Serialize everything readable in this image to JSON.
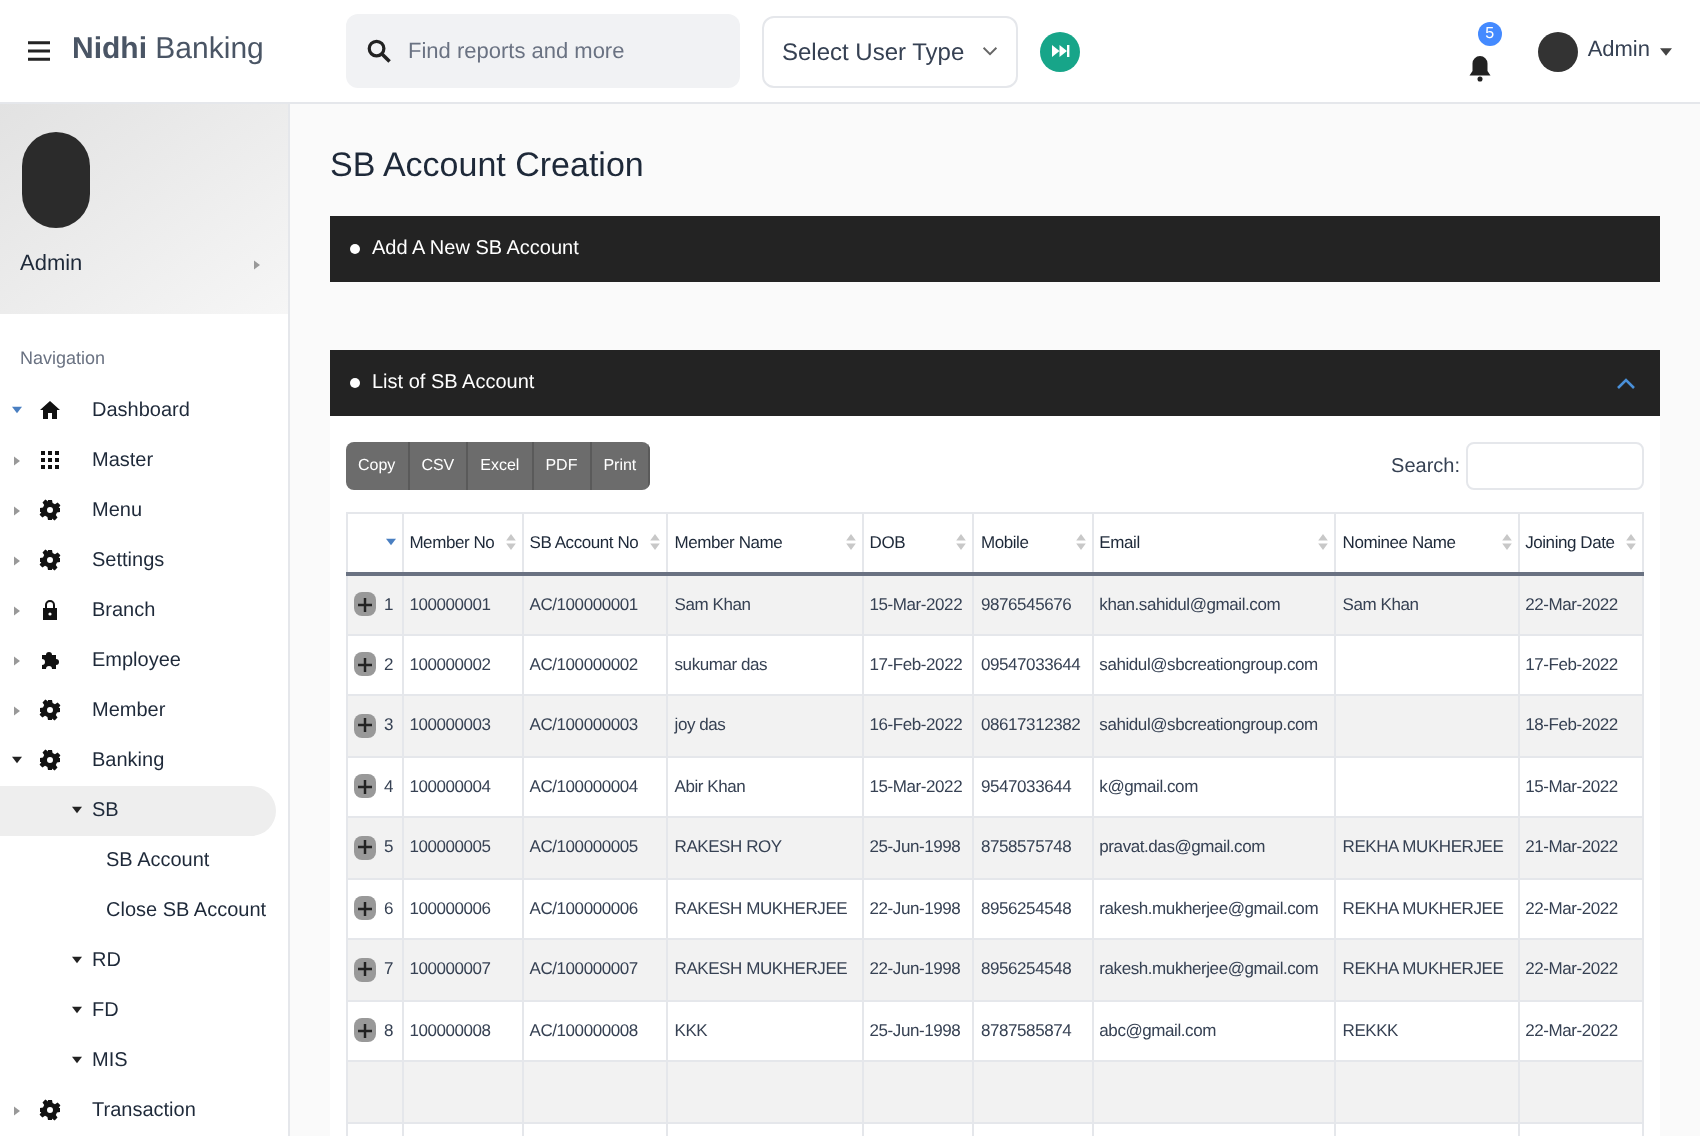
{
  "header": {
    "brand": "**Nidhi** Banking",
    "search": {
      "placeholder": "Find reports and more"
    },
    "user_type_select": {
      "value": "Select User Type"
    },
    "notification_count": "5",
    "user": "Admin"
  },
  "sidebar": {
    "profile_name": "Admin",
    "section_label": "Navigation",
    "items": [
      {
        "label": "Dashboard",
        "expanded": true
      },
      {
        "label": "Master",
        "expanded": false
      },
      {
        "label": "Menu",
        "expanded": false
      },
      {
        "label": "Settings",
        "expanded": false
      },
      {
        "label": "Branch",
        "expanded": false
      },
      {
        "label": "Employee",
        "expanded": false
      },
      {
        "label": "Member",
        "expanded": false
      },
      {
        "label": "Banking",
        "expanded": true,
        "children": [
          {
            "label": "SB",
            "selected": true,
            "children": [
              {
                "label": "SB Account"
              },
              {
                "label": "Close SB Account"
              }
            ]
          },
          {
            "label": "RD",
            "selected": false
          },
          {
            "label": "FD",
            "selected": false
          },
          {
            "label": "MIS",
            "selected": false
          }
        ]
      },
      {
        "label": "Transaction",
        "expanded": false
      }
    ]
  },
  "page": {
    "title": "SB Account Creation",
    "add_panel": {
      "title": "Add A New SB Account"
    },
    "list_panel": {
      "title": "List of SB Account",
      "expanded": true,
      "export_buttons": [
        "Copy",
        "CSV",
        "Excel",
        "PDF",
        "Print"
      ],
      "search_label": "Search:",
      "table": {
        "columns": [
          {
            "sorted": true
          },
          {
            "label": "Member No",
            "sorted": false
          },
          {
            "label": "SB Account No",
            "sorted": false
          },
          {
            "label": "Member Name",
            "sorted": false
          },
          {
            "label": "DOB",
            "sorted": false
          },
          {
            "label": "Mobile",
            "sorted": false
          },
          {
            "label": "Email",
            "sorted": false
          },
          {
            "label": "Nominee Name",
            "sorted": false
          },
          {
            "label": "Joining Date",
            "sorted": false
          }
        ],
        "rows": [
          {
            "cells": [
              "1",
              "100000001",
              "AC/100000001",
              "Sam Khan",
              "15-Mar-2022",
              "9876545676",
              "khan.sahidul@gmail.com",
              "Sam Khan",
              "22-Mar-2022"
            ]
          },
          {
            "cells": [
              "2",
              "100000002",
              "AC/100000002",
              "sukumar das",
              "17-Feb-2022",
              "09547033644",
              "sahidul@sbcreationgroup.com",
              "",
              "17-Feb-2022"
            ]
          },
          {
            "cells": [
              "3",
              "100000003",
              "AC/100000003",
              "joy das",
              "16-Feb-2022",
              "08617312382",
              "sahidul@sbcreationgroup.com",
              "",
              "18-Feb-2022"
            ]
          },
          {
            "cells": [
              "4",
              "100000004",
              "AC/100000004",
              "Abir Khan",
              "15-Mar-2022",
              "9547033644",
              "k@gmail.com",
              "",
              "15-Mar-2022"
            ]
          },
          {
            "cells": [
              "5",
              "100000005",
              "AC/100000005",
              "RAKESH ROY",
              "25-Jun-1998",
              "8758575748",
              "pravat.das@gmail.com",
              "REKHA MUKHERJEE",
              "21-Mar-2022"
            ]
          },
          {
            "cells": [
              "6",
              "100000006",
              "AC/100000006",
              "RAKESH MUKHERJEE",
              "22-Jun-1998",
              "8956254548",
              "rakesh.mukherjee@gmail.com",
              "REKHA MUKHERJEE",
              "22-Mar-2022"
            ]
          },
          {
            "cells": [
              "7",
              "100000007",
              "AC/100000007",
              "RAKESH MUKHERJEE",
              "22-Jun-1998",
              "8956254548",
              "rakesh.mukherjee@gmail.com",
              "REKHA MUKHERJEE",
              "22-Mar-2022"
            ]
          },
          {
            "cells": [
              "8",
              "100000008",
              "AC/100000008",
              "KKK",
              "25-Jun-1998",
              "8787585874",
              "abc@gmail.com",
              "REKKK",
              "22-Mar-2022"
            ]
          }
        ]
      }
    }
  }
}
